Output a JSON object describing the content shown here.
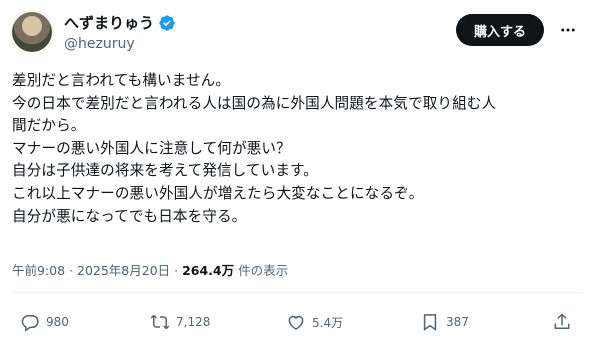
{
  "user": {
    "display_name": "へずまりゅう",
    "handle": "@hezuruy"
  },
  "buttons": {
    "subscribe": "購入する"
  },
  "post": {
    "lines": [
      "差別だと言われても構いません。",
      "今の日本で差別だと言われる人は国の為に外国人問題を本気で取り組む人",
      "間だから。",
      "マナーの悪い外国人に注意して何が悪い？",
      "自分は子供達の将来を考えて発信しています。",
      "これ以上マナーの悪い外国人が増えたら大変なことになるぞ。",
      "自分が悪になってでも日本を守る。"
    ]
  },
  "meta": {
    "time": "午前9:08",
    "sep1": " · ",
    "date": "2025年8月20日",
    "sep2": " · ",
    "views": "264.4万",
    "views_suffix": " 件の表示"
  },
  "actions": {
    "replies": "980",
    "reposts": "7,128",
    "likes": "5.4万",
    "bookmarks": "387"
  },
  "icons": {
    "verified": "verified-badge-icon",
    "more": "more-icon",
    "reply": "reply-icon",
    "repost": "repost-icon",
    "like": "heart-icon",
    "bookmark": "bookmark-icon",
    "share": "share-icon"
  },
  "colors": {
    "verified": "#1d9bf0",
    "text": "#0f1419",
    "muted": "#536471",
    "button_bg": "#0f1419"
  }
}
